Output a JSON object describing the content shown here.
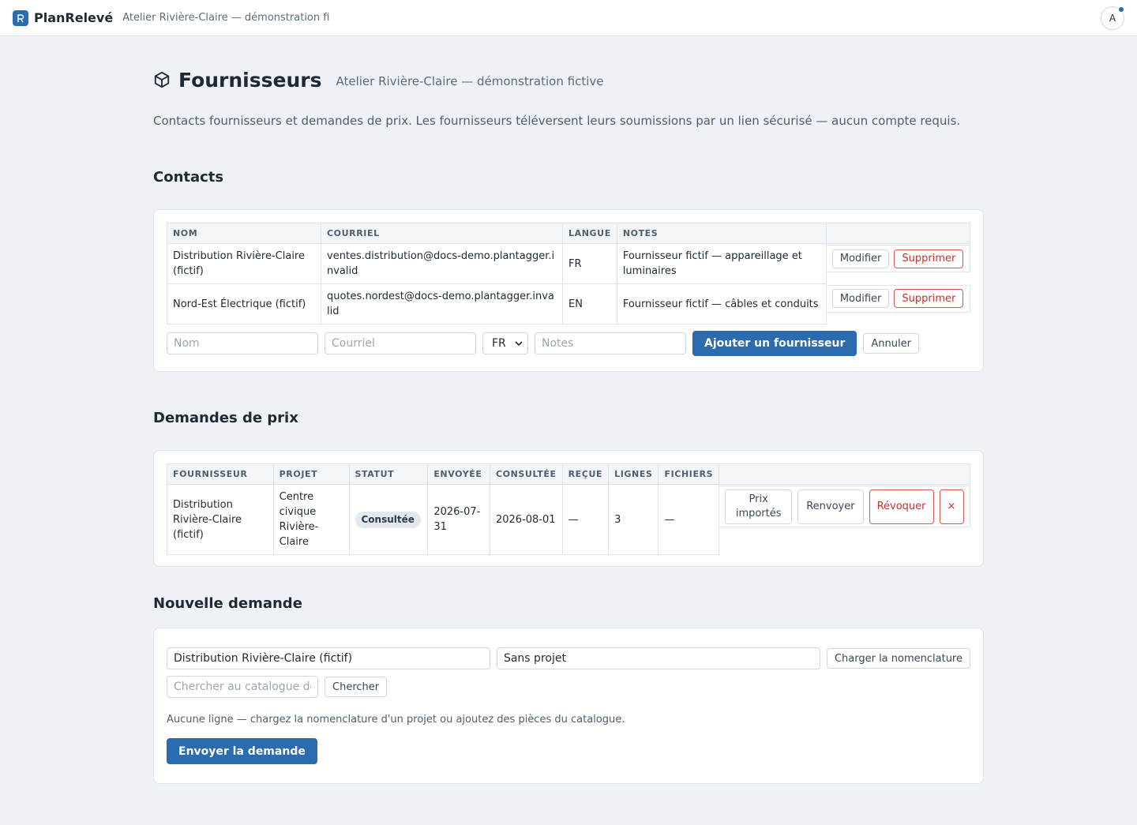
{
  "topbar": {
    "brand": "PlanRelevé",
    "org": "Atelier Rivière-Claire — démonstration fictive",
    "avatar": "A"
  },
  "page": {
    "title": "Fournisseurs",
    "subtitle": "Atelier Rivière-Claire — démonstration fictive",
    "intro": "Contacts fournisseurs et demandes de prix. Les fournisseurs téléversent leurs soumissions par un lien sécurisé — aucun compte requis."
  },
  "contacts": {
    "heading": "Contacts",
    "headers": [
      "NOM",
      "COURRIEL",
      "LANGUE",
      "NOTES"
    ],
    "rows": [
      {
        "name": "Distribution Rivière-Claire (fictif)",
        "email": "ventes.distribution@docs-demo.plantagger.invalid",
        "lang": "FR",
        "notes": "Fournisseur fictif — appareillage et luminaires",
        "edit": "Modifier",
        "delete": "Supprimer"
      },
      {
        "name": "Nord-Est Électrique (fictif)",
        "email": "quotes.nordest@docs-demo.plantagger.invalid",
        "lang": "EN",
        "notes": "Fournisseur fictif — câbles et conduits",
        "edit": "Modifier",
        "delete": "Supprimer"
      }
    ],
    "form": {
      "name_placeholder": "Nom",
      "email_placeholder": "Courriel",
      "lang_value": "FR",
      "notes_placeholder": "Notes",
      "add_label": "Ajouter un fournisseur",
      "cancel_label": "Annuler"
    }
  },
  "requests": {
    "heading": "Demandes de prix",
    "headers": [
      "FOURNISSEUR",
      "PROJET",
      "STATUT",
      "ENVOYÉE",
      "CONSULTÉE",
      "REÇUE",
      "LIGNES",
      "FICHIERS"
    ],
    "rows": [
      {
        "supplier": "Distribution Rivière-Claire (fictif)",
        "project": "Centre civique Rivière-Claire",
        "status": "Consultée",
        "sent": "2026-07-31",
        "viewed": "2026-08-01",
        "received": "—",
        "lines": "3",
        "files": "—",
        "imported": "Prix importés",
        "resend": "Renvoyer",
        "revoke": "Révoquer",
        "remove": "×"
      }
    ]
  },
  "new_request": {
    "heading": "Nouvelle demande",
    "supplier_value": "Distribution Rivière-Claire (fictif)",
    "project_value": "Sans projet",
    "load_bom": "Charger la nomenclature",
    "search_placeholder": "Chercher au catalogue de pièces",
    "search_button": "Chercher",
    "empty_text": "Aucune ligne — chargez la nomenclature d'un projet ou ajoutez des pièces du catalogue.",
    "send_label": "Envoyer la demande"
  }
}
